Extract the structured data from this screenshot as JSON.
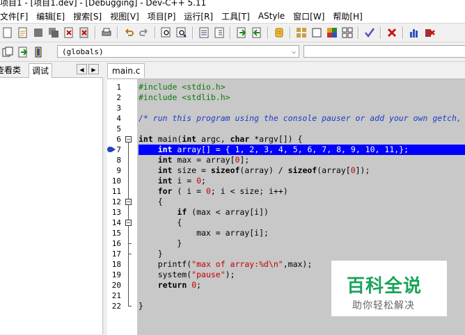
{
  "title": "项目1 - [项目1.dev] - [Debugging] - Dev-C++ 5.11",
  "menu": [
    "文件[F]",
    "编辑[E]",
    "搜索[S]",
    "视图[V]",
    "项目[P]",
    "运行[R]",
    "工具[T]",
    "AStyle",
    "窗口[W]",
    "帮助[H]"
  ],
  "toolbar_icons": [
    "new-icon",
    "open-icon",
    "save-icon",
    "save-all-icon",
    "close-icon",
    "close-all-icon",
    "print-icon",
    "undo-icon",
    "redo-icon",
    "find-icon",
    "replace-icon",
    "goto-icon",
    "indent-icon",
    "outdent-icon",
    "bookmark-icon",
    "compile-icon",
    "run-icon",
    "compile-run-icon",
    "rebuild-icon",
    "check-icon",
    "stop-icon",
    "chart-icon",
    "debug-icon"
  ],
  "combo": {
    "value": "(globals)"
  },
  "left_tabs": {
    "tab1": "查看类",
    "tab2": "调试"
  },
  "file_tab": "main.c",
  "line_numbers": [
    "1",
    "2",
    "3",
    "4",
    "5",
    "6",
    "7",
    "8",
    "9",
    "10",
    "11",
    "12",
    "13",
    "14",
    "15",
    "16",
    "17",
    "18",
    "19",
    "20",
    "21",
    "22"
  ],
  "code": {
    "l1": "#include <stdio.h>",
    "l2": "#include <stdlib.h>",
    "l4": "/* run this program using the console pauser or add your own getch, system(\"pause\") or input loop */",
    "l6a": "int",
    " l6b": " main(",
    "l6c": "int",
    " l6d": " argc, ",
    "l6e": "char",
    " l6f": " *argv[]) {",
    "l7a": "    ",
    "l7b": "int",
    " l7c": " array[] = { ",
    "l7d": "1",
    ", 2": ""
  },
  "watermark": {
    "logo": "百科全说",
    "sub": "助你轻松解决"
  }
}
